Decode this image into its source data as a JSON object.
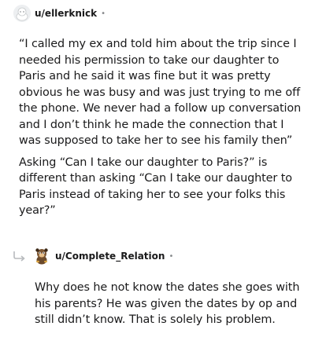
{
  "comments": [
    {
      "username": "u/ellerknick",
      "separator": "•",
      "avatar_icon": "snoo-avatar-icon",
      "paragraphs": [
        "“I called my ex and told him about the trip since I needed his permission to take our daughter to Paris and he said it was fine but it was pretty obvious he was busy and was just trying to me off the phone. We never had a follow up conversation and I don’t think he made the connection that I was supposed to take her to see his family then”",
        "Asking “Can I take our daughter to Paris?” is different than asking “Can I take our daughter to Paris instead of taking her to see your folks this year?”"
      ]
    },
    {
      "username": "u/Complete_Relation",
      "separator": "•",
      "avatar_icon": "snoo-avatar-icon",
      "reply_icon": "reply-arrow-icon",
      "paragraphs": [
        "Why does he not know the dates she goes with his parents? He was given the dates by op and still didn’t know. That is solely his problem."
      ]
    }
  ]
}
